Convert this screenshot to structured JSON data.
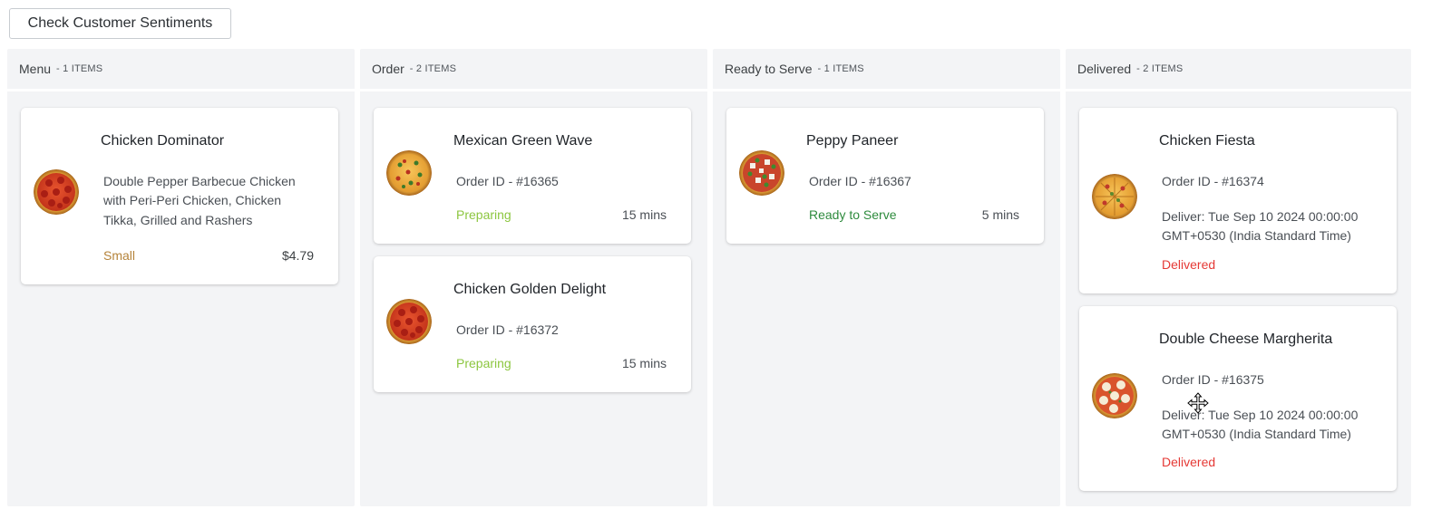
{
  "toolbar": {
    "sentiment_button": "Check Customer Sentiments"
  },
  "colors": {
    "column_bg": "#f3f4f6",
    "preparing": "#8cc63f",
    "ready": "#2e8b3d",
    "delivered": "#e53935",
    "size": "#b5833a"
  },
  "columns": [
    {
      "title": "Menu",
      "count": "- 1 ITEMS",
      "cards": [
        {
          "name": "Chicken Dominator",
          "description": "Double Pepper Barbecue Chicken with Peri-Peri Chicken, Chicken Tikka, Grilled and Rashers",
          "desc_lines": [
            "Double Pepper Barbecue Chicken",
            "with Peri-Peri Chicken, Chicken",
            "Tikka, Grilled and Rashers"
          ],
          "size": "Small",
          "price": "$4.79",
          "image": "pepperoni-pizza-icon"
        }
      ]
    },
    {
      "title": "Order",
      "count": "- 2 ITEMS",
      "cards": [
        {
          "name": "Mexican Green Wave",
          "order_id": "Order ID - #16365",
          "status": "Preparing",
          "time": "15 mins",
          "image": "veggie-pizza-icon"
        },
        {
          "name": "Chicken Golden Delight",
          "order_id": "Order ID - #16372",
          "status": "Preparing",
          "time": "15 mins",
          "image": "pepperoni-pizza-icon"
        }
      ]
    },
    {
      "title": "Ready to Serve",
      "count": "- 1 ITEMS",
      "cards": [
        {
          "name": "Peppy Paneer",
          "order_id": "Order ID - #16367",
          "status": "Ready to Serve",
          "time": "5 mins",
          "image": "paneer-pizza-icon"
        }
      ]
    },
    {
      "title": "Delivered",
      "count": "- 2 ITEMS",
      "cards": [
        {
          "name": "Chicken Fiesta",
          "order_id": "Order ID - #16374",
          "deliver_lines": [
            "Deliver: Tue Sep 10 2024 00:00:00",
            "GMT+0530 (India Standard Time)"
          ],
          "status": "Delivered",
          "image": "sliced-pizza-icon"
        },
        {
          "name": "Double Cheese Margherita",
          "order_id": "Order ID - #16375",
          "deliver_lines": [
            "Deliver: Tue Sep 10 2024 00:00:00",
            "GMT+0530 (India Standard Time)"
          ],
          "status": "Delivered",
          "image": "margherita-pizza-icon"
        }
      ]
    }
  ]
}
